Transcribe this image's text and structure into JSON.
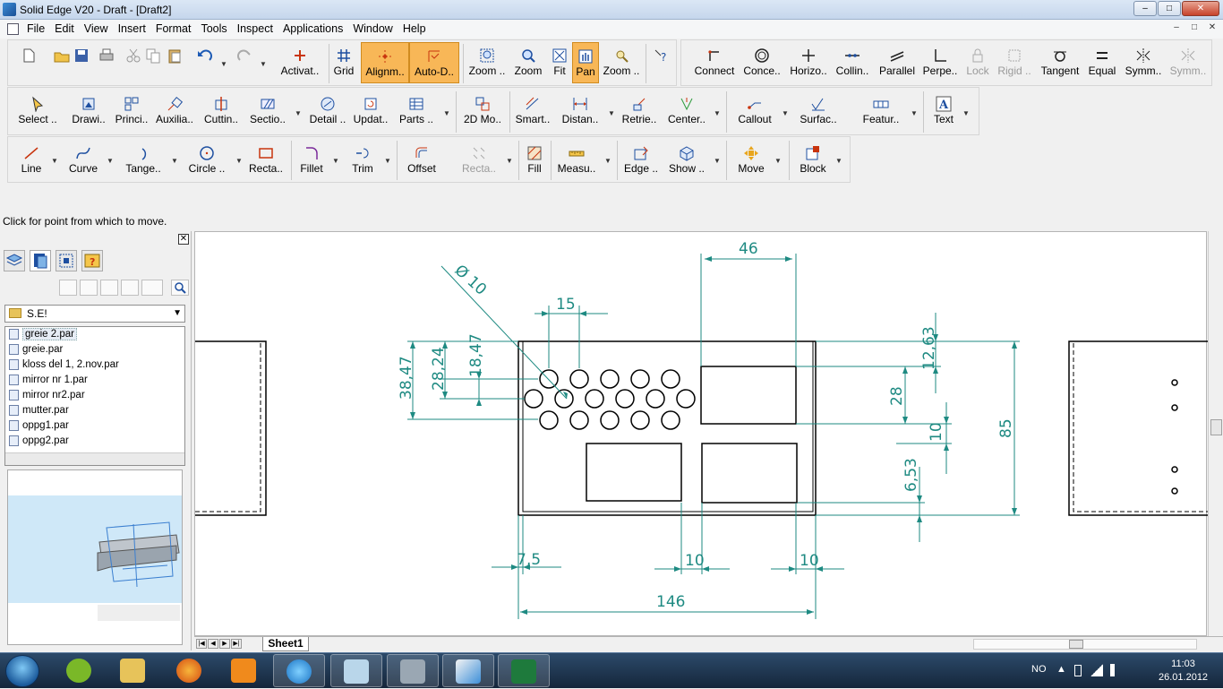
{
  "window": {
    "title": "Solid Edge V20 - Draft - [Draft2]",
    "controls": [
      "–",
      "□",
      "✕"
    ]
  },
  "menu": [
    "File",
    "Edit",
    "View",
    "Insert",
    "Format",
    "Tools",
    "Inspect",
    "Applications",
    "Window",
    "Help"
  ],
  "mdi_controls": [
    "–",
    "□",
    "✕"
  ],
  "toolbar1": {
    "activate": "Activat..",
    "grid": "Grid",
    "align": "Alignm..",
    "autod": "Auto-D..",
    "zoom1": "Zoom ..",
    "zoom2": "Zoom",
    "fit": "Fit",
    "pan": "Pan",
    "zoom3": "Zoom .."
  },
  "toolbar_rel": {
    "connect": "Connect",
    "concentric": "Conce..",
    "horizontal": "Horizo..",
    "collinear": "Collin..",
    "parallel": "Parallel",
    "perpendicular": "Perpe..",
    "lock": "Lock",
    "rigid": "Rigid ..",
    "tangent": "Tangent",
    "equal": "Equal",
    "symmetric1": "Symm..",
    "symmetric2": "Symm.."
  },
  "toolbar2": {
    "select": "Select ..",
    "drawing": "Drawi..",
    "principal": "Princi..",
    "auxiliary": "Auxilia..",
    "cutting": "Cuttin..",
    "section": "Sectio..",
    "detail": "Detail ..",
    "update": "Updat..",
    "parts": "Parts ..",
    "model2d": "2D Mo..",
    "smart": "Smart..",
    "distance": "Distan..",
    "retrieve": "Retrie..",
    "center": "Center..",
    "callout": "Callout",
    "surface": "Surfac..",
    "feature": "Featur..",
    "text": "Text"
  },
  "toolbar3": {
    "line": "Line",
    "curve": "Curve",
    "tangent": "Tange..",
    "circle": "Circle ..",
    "rect": "Recta..",
    "fillet": "Fillet",
    "trim": "Trim",
    "offset": "Offset",
    "rect2": "Recta..",
    "fill": "Fill",
    "measure": "Measu..",
    "edge": "Edge ..",
    "show": "Show ..",
    "move": "Move",
    "block": "Block"
  },
  "status": "Click for point from which to move.",
  "library": {
    "folder": "S.E!",
    "files": [
      "greie 2.par",
      "greie.par",
      "kloss del 1, 2.nov.par",
      "mirror nr 1.par",
      "mirror nr2.par",
      "mutter.par",
      "oppg1.par",
      "oppg2.par"
    ]
  },
  "drawing": {
    "dims": {
      "d46": "46",
      "d15": "15",
      "dia": "Ø 10",
      "d3847": "38,47",
      "d2824": "28,24",
      "d1847": "18,47",
      "d1263": "12,63",
      "d28": "28",
      "d10v": "10",
      "d85": "85",
      "d653": "6,53",
      "d75": "7,5",
      "d10a": "10",
      "d10b": "10",
      "d146": "146"
    }
  },
  "sheet_tab": "Sheet1",
  "taskbar": {
    "language": "NO",
    "time": "11:03",
    "date": "26.01.2012"
  }
}
